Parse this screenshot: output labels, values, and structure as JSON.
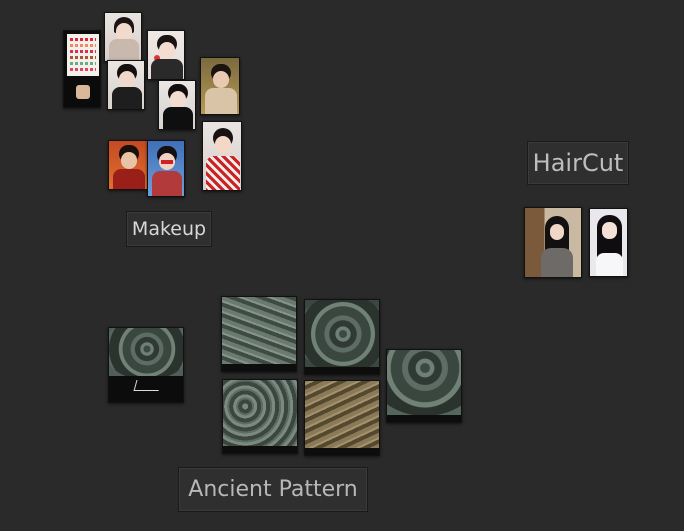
{
  "groups": {
    "makeup": {
      "label": "Makeup"
    },
    "haircut": {
      "label": "HairCut"
    },
    "ancient_pattern": {
      "label": "Ancient Pattern"
    }
  },
  "colors": {
    "background": "#2a2a2a",
    "label_bg": "#2f2f2f",
    "label_text": "#d8d8d8"
  },
  "cards": {
    "makeup_count": 11,
    "haircut_count": 2,
    "ancient_pattern_count": 6
  }
}
